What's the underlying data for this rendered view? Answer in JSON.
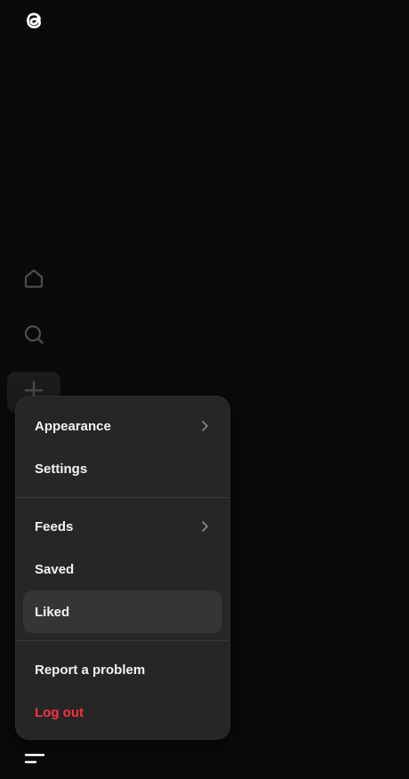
{
  "app": {
    "logo_icon": "threads-logo-icon"
  },
  "sidebar": {
    "items": [
      {
        "name": "home",
        "icon": "home-icon"
      },
      {
        "name": "search",
        "icon": "search-icon"
      },
      {
        "name": "create",
        "icon": "plus-icon"
      }
    ],
    "menu_icon": "menu-icon"
  },
  "menu": {
    "appearance_label": "Appearance",
    "settings_label": "Settings",
    "feeds_label": "Feeds",
    "saved_label": "Saved",
    "liked_label": "Liked",
    "report_label": "Report a problem",
    "logout_label": "Log out"
  },
  "colors": {
    "background": "#0a0a0a",
    "menu_bg": "#262626",
    "active_item_bg": "#353535",
    "text": "#f3f3f3",
    "danger": "#ff3040",
    "icon_muted": "#4d4d4d"
  }
}
